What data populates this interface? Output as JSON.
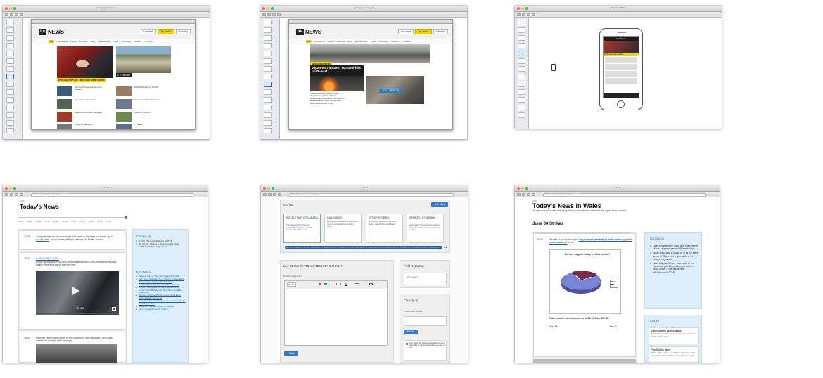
{
  "colors": {
    "itv_yellow": "#f5d300",
    "link_blue": "#1f5fb0",
    "accent_blue": "#2f7bd2",
    "pane_blue": "#ddeefa",
    "selection_blue": "#3b74d8"
  },
  "panel1": {
    "window_title": "prototype_Forms_v1",
    "logo": "itv",
    "logo_word": "NEWS",
    "nav_buttons": [
      "Live news",
      "Top stories",
      "Following"
    ],
    "nav": [
      "All",
      "International",
      "Politics",
      "Business",
      "Sport",
      "Entertainment",
      "Travel",
      "Technology",
      "Weather",
      "ITV Wales"
    ],
    "lead_caption": "SPECIAL REPORT : NHS cuts under review",
    "second_caption": "ITV Meridian",
    "stories": [
      "Cameron's Clegg Lamont: Cuts revealed",
      "Rubbish Piles Sit on Oxford",
      "Fire nears nuclear plant",
      "Tsunami relief fund launched",
      "Japan faces toll after the quake",
      "Floods hit the North",
      "Anglia Widget News",
      "ITV Wales"
    ]
  },
  "panel2": {
    "window_title": "prototype_Forms_v2",
    "lead_caption": "BREAKING NEWS",
    "headline": "Japan earthquake: Tsunami hits north-east",
    "live_button": "ITV LIVE NOW",
    "list": [
      "Tsunami waves hit Japan's coast",
      "Aftershocks continue in Tokyo",
      "Nuclear plant evacuation zone widened",
      "Rescue teams arrive from overseas",
      "Death toll expected to rise"
    ]
  },
  "panel3": {
    "window_title": "Browse / Birth",
    "phone_header": "ITV News",
    "phone_caption": "NHS cuts under review"
  },
  "panel4": {
    "window_title": "Untitled",
    "url": "Search Google or enter an address",
    "live": "LIVE",
    "title": "Today's News",
    "timeline": [
      "09:30",
      "09:30",
      "10:30",
      "11:30",
      "11:30",
      "12:30",
      "13:30",
      "14:30",
      "15:30",
      "16:30",
      "17:30"
    ],
    "entries": [
      {
        "time": "17:20",
        "text": "Today's livestream has now ended. For news on the day's top stories, go to ",
        "link": "itv.com/news",
        "tail": ", on our Facebook Page or follow our Twitter account"
      },
      {
        "time": "16:47",
        "headline": "A WE NO RELEASED",
        "text": "Before he was jailed by China, Ai Wei Wei speaks to our Correspondent Angus Walker. Here's his report from the time.",
        "video_time": "32:00"
      },
      {
        "time": "16:47",
        "text": "Reporter Fleur Hopkin sends us this video from Sam Albertson's first press conference as West Ham manager."
      }
    ],
    "coming_up_heading": "Coming up",
    "coming_up": [
      "18:30: ITV Evening News on ITV1",
      "01:00 AM: Obama to announce US troop withdrawals from Afghanistan"
    ],
    "key_points_heading": "Key points:",
    "key_points": [
      "Strikes strike Ai Wei Wei released on bail",
      "US Open champion Rory McIlroy returns to his home golf club in Northern Ireland",
      "Ai Wei Wei spokesperson calls for inquiry",
      "PRIAs: 'comprehensive and overwhelming' evidence of Muhammed Gin Hammam bribe attempts",
      "Rescue says half British troops withdrawals have already happened",
      "Greece passes crucial vote as government wins confidence vote",
      "Michelle Obama's speech in Soweto",
      "Jay's responds simply to Ed's"
    ]
  },
  "panel5": {
    "window_title": "Untitled",
    "stories_heading": "Stories",
    "new_story": "New story",
    "stories": [
      {
        "title": "ROYAL TOUR OF CANADA",
        "body": "The Duke and Duchess of Cambridge begin their tour of Canada. It's William and ..."
      },
      {
        "title": "RAIL CRISIS",
        "body": "Emergency legislation is planned to avert a continental court ruling yield..."
      },
      {
        "title": "OTHER STORIES",
        "body": "A summary of some of the other stories making the news today..."
      },
      {
        "title": "STRIKES HIT BRITAIN",
        "body": "Hundreds of thousands of teachers and other public sector workers are striking t..."
      }
    ],
    "live_stream_heading": "Live Stream for 'ROYAL TOUR OF CANADA'",
    "publish_label": "Publish new content",
    "editor_tools": [
      "Source",
      "B",
      "I",
      "U"
    ],
    "publish_button": "Publish",
    "field_reporting": "Field Reporting",
    "field_text": "Test content",
    "coming_up": "Coming up...",
    "coming_publish_label": "Publish new content",
    "coming_publish": "Publish",
    "comment": "Kerr: How the strikes have affected your area. We're latest news where you are on ITV"
  },
  "panel6": {
    "window_title": "Untitled",
    "url": "Search Google or enter an address",
    "live": "LIVE",
    "title": "Today's News in Wales",
    "intro": "To see stories in this live blog click on the stories listed in the right hand column",
    "section": "June 30 Strikes",
    "entry_time": "10:12",
    "entry_text": "Results of our facebook poll ",
    "entry_link": "Do you agree with today's strike action by public sector workers?",
    "entry_tail": " so far",
    "poll_title": "Do You support today's strike action?",
    "poll_legend": [
      "Yes",
      "No"
    ],
    "poll_total": "Total number of votes cast as of 16:00 June 30 - 50.",
    "poll_yes": "Yes: 39",
    "poll_no": "No: 11",
    "coming_up_heading": "Coming up",
    "coming_up": [
      "Later this afternoon we'll have more on the strikes happening around Wales today",
      "18:00 We'll have a round up of all the strike action in Wales with a special June 30 strikes programme.",
      "Later today we'll have the results of our Facebook poll: Do you support today's strike action? Vote online now: http://itv.com/AAGHP"
    ],
    "stories_heading": "Stories",
    "stories": [
      {
        "title": "Other Stories across Wales",
        "body": "Here are the stories we are covering elsewhere in the news today."
      },
      {
        "title": "The Strikes Story",
        "body": "What is the personal row about and how much are government workers being asked to pay?"
      }
    ]
  },
  "chart_data": {
    "type": "pie",
    "title": "Do You support today's strike action?",
    "categories": [
      "Yes",
      "No"
    ],
    "values": [
      39,
      11
    ]
  }
}
